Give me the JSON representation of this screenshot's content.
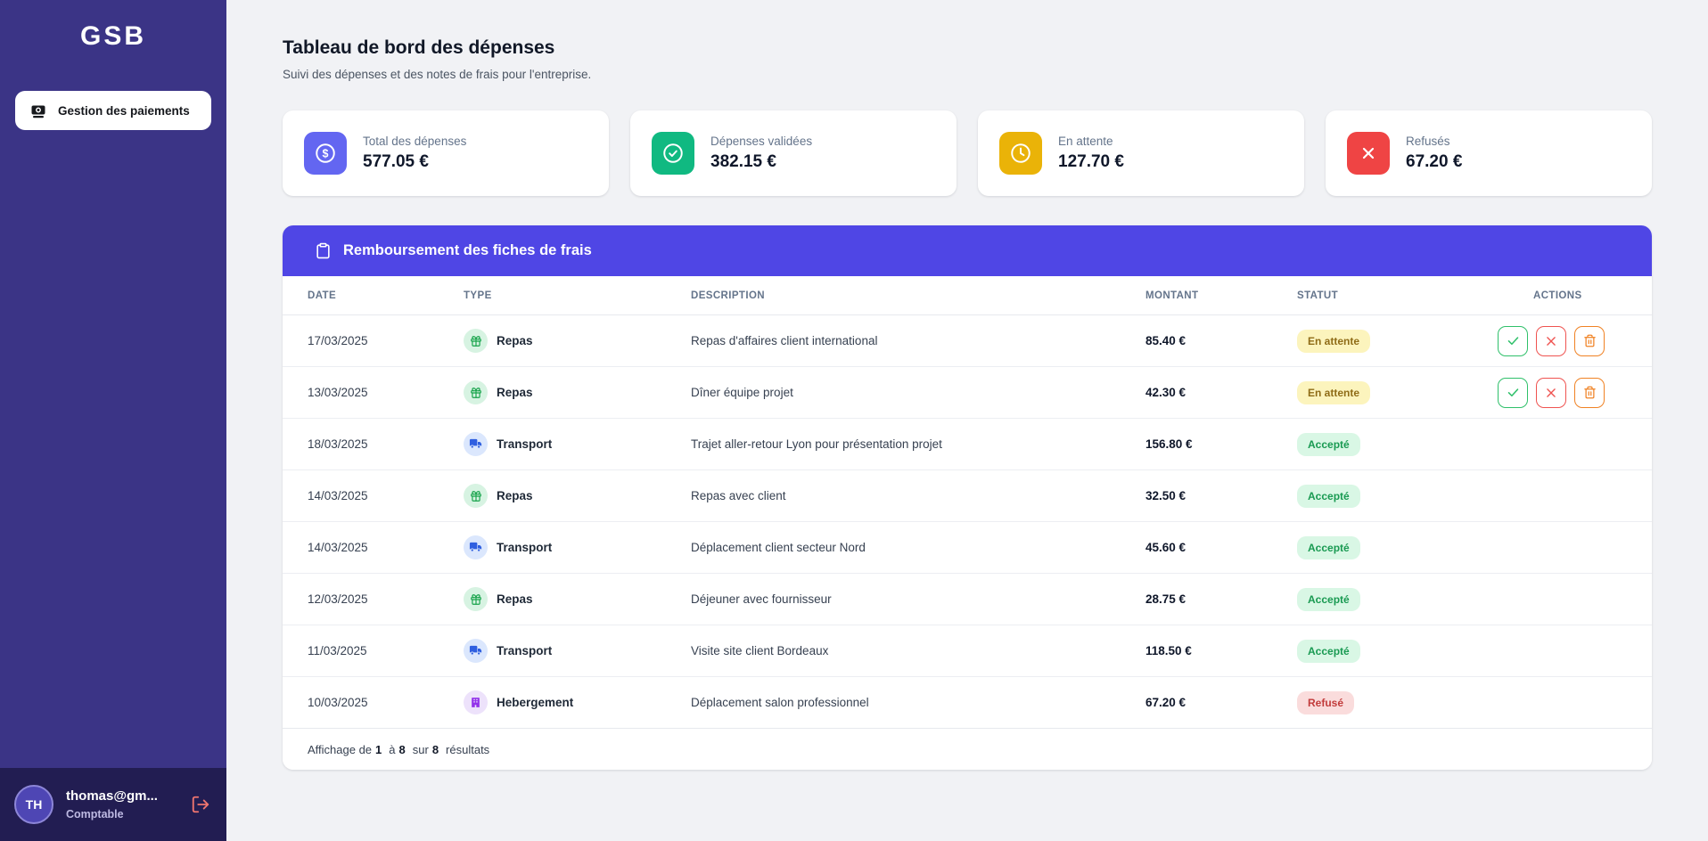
{
  "sidebar": {
    "logo": "GSB",
    "nav": [
      {
        "label": "Gestion des paiements",
        "icon": "payments-icon"
      }
    ],
    "user": {
      "initials": "TH",
      "email": "thomas@gm...",
      "role": "Comptable",
      "logout_icon": "logout-icon"
    }
  },
  "header": {
    "title": "Tableau de bord des dépenses",
    "subtitle": "Suivi des dépenses et des notes de frais pour l'entreprise."
  },
  "stats": [
    {
      "label": "Total des dépenses",
      "value": "577.05 €",
      "icon": "dollar-circle-icon",
      "color": "#6366f1"
    },
    {
      "label": "Dépenses validées",
      "value": "382.15 €",
      "icon": "check-circle-icon",
      "color": "#10b981"
    },
    {
      "label": "En attente",
      "value": "127.70 €",
      "icon": "clock-icon",
      "color": "#eab308"
    },
    {
      "label": "Refusés",
      "value": "67.20 €",
      "icon": "x-icon",
      "color": "#ef4444"
    }
  ],
  "table": {
    "title": "Remboursement des fiches de frais",
    "title_icon": "clipboard-icon",
    "columns": {
      "date": "DATE",
      "type": "TYPE",
      "description": "DESCRIPTION",
      "montant": "MONTANT",
      "statut": "STATUT",
      "actions": "ACTIONS"
    },
    "rows": [
      {
        "date": "17/03/2025",
        "type": "Repas",
        "type_kind": "repas",
        "description": "Repas d'affaires client international",
        "montant": "85.40 €",
        "statut": "En attente",
        "statut_kind": "pending",
        "actions": true
      },
      {
        "date": "13/03/2025",
        "type": "Repas",
        "type_kind": "repas",
        "description": "Dîner équipe projet",
        "montant": "42.30 €",
        "statut": "En attente",
        "statut_kind": "pending",
        "actions": true
      },
      {
        "date": "18/03/2025",
        "type": "Transport",
        "type_kind": "transport",
        "description": "Trajet aller-retour Lyon pour présentation projet",
        "montant": "156.80 €",
        "statut": "Accepté",
        "statut_kind": "accepted",
        "actions": false
      },
      {
        "date": "14/03/2025",
        "type": "Repas",
        "type_kind": "repas",
        "description": "Repas avec client",
        "montant": "32.50 €",
        "statut": "Accepté",
        "statut_kind": "accepted",
        "actions": false
      },
      {
        "date": "14/03/2025",
        "type": "Transport",
        "type_kind": "transport",
        "description": "Déplacement client secteur Nord",
        "montant": "45.60 €",
        "statut": "Accepté",
        "statut_kind": "accepted",
        "actions": false
      },
      {
        "date": "12/03/2025",
        "type": "Repas",
        "type_kind": "repas",
        "description": "Déjeuner avec fournisseur",
        "montant": "28.75 €",
        "statut": "Accepté",
        "statut_kind": "accepted",
        "actions": false
      },
      {
        "date": "11/03/2025",
        "type": "Transport",
        "type_kind": "transport",
        "description": "Visite site client Bordeaux",
        "montant": "118.50 €",
        "statut": "Accepté",
        "statut_kind": "accepted",
        "actions": false
      },
      {
        "date": "10/03/2025",
        "type": "Hebergement",
        "type_kind": "hebergement",
        "description": "Déplacement salon professionnel",
        "montant": "67.20 €",
        "statut": "Refusé",
        "statut_kind": "refused",
        "actions": false
      }
    ],
    "footer": {
      "prefix": "Affichage de",
      "from": "1",
      "a": "à",
      "to": "8",
      "sur": "sur",
      "total": "8",
      "suffix": "résultats"
    }
  },
  "colors": {
    "sidebar_bg": "#3b3486",
    "sidebar_user_bg": "#221d52",
    "banner_bg": "#4f46e5",
    "page_bg": "#f1f2f5",
    "badge_pending_bg": "#fcf4bd",
    "badge_accepted_bg": "#d9f7e5",
    "badge_refused_bg": "#fadcdc"
  }
}
